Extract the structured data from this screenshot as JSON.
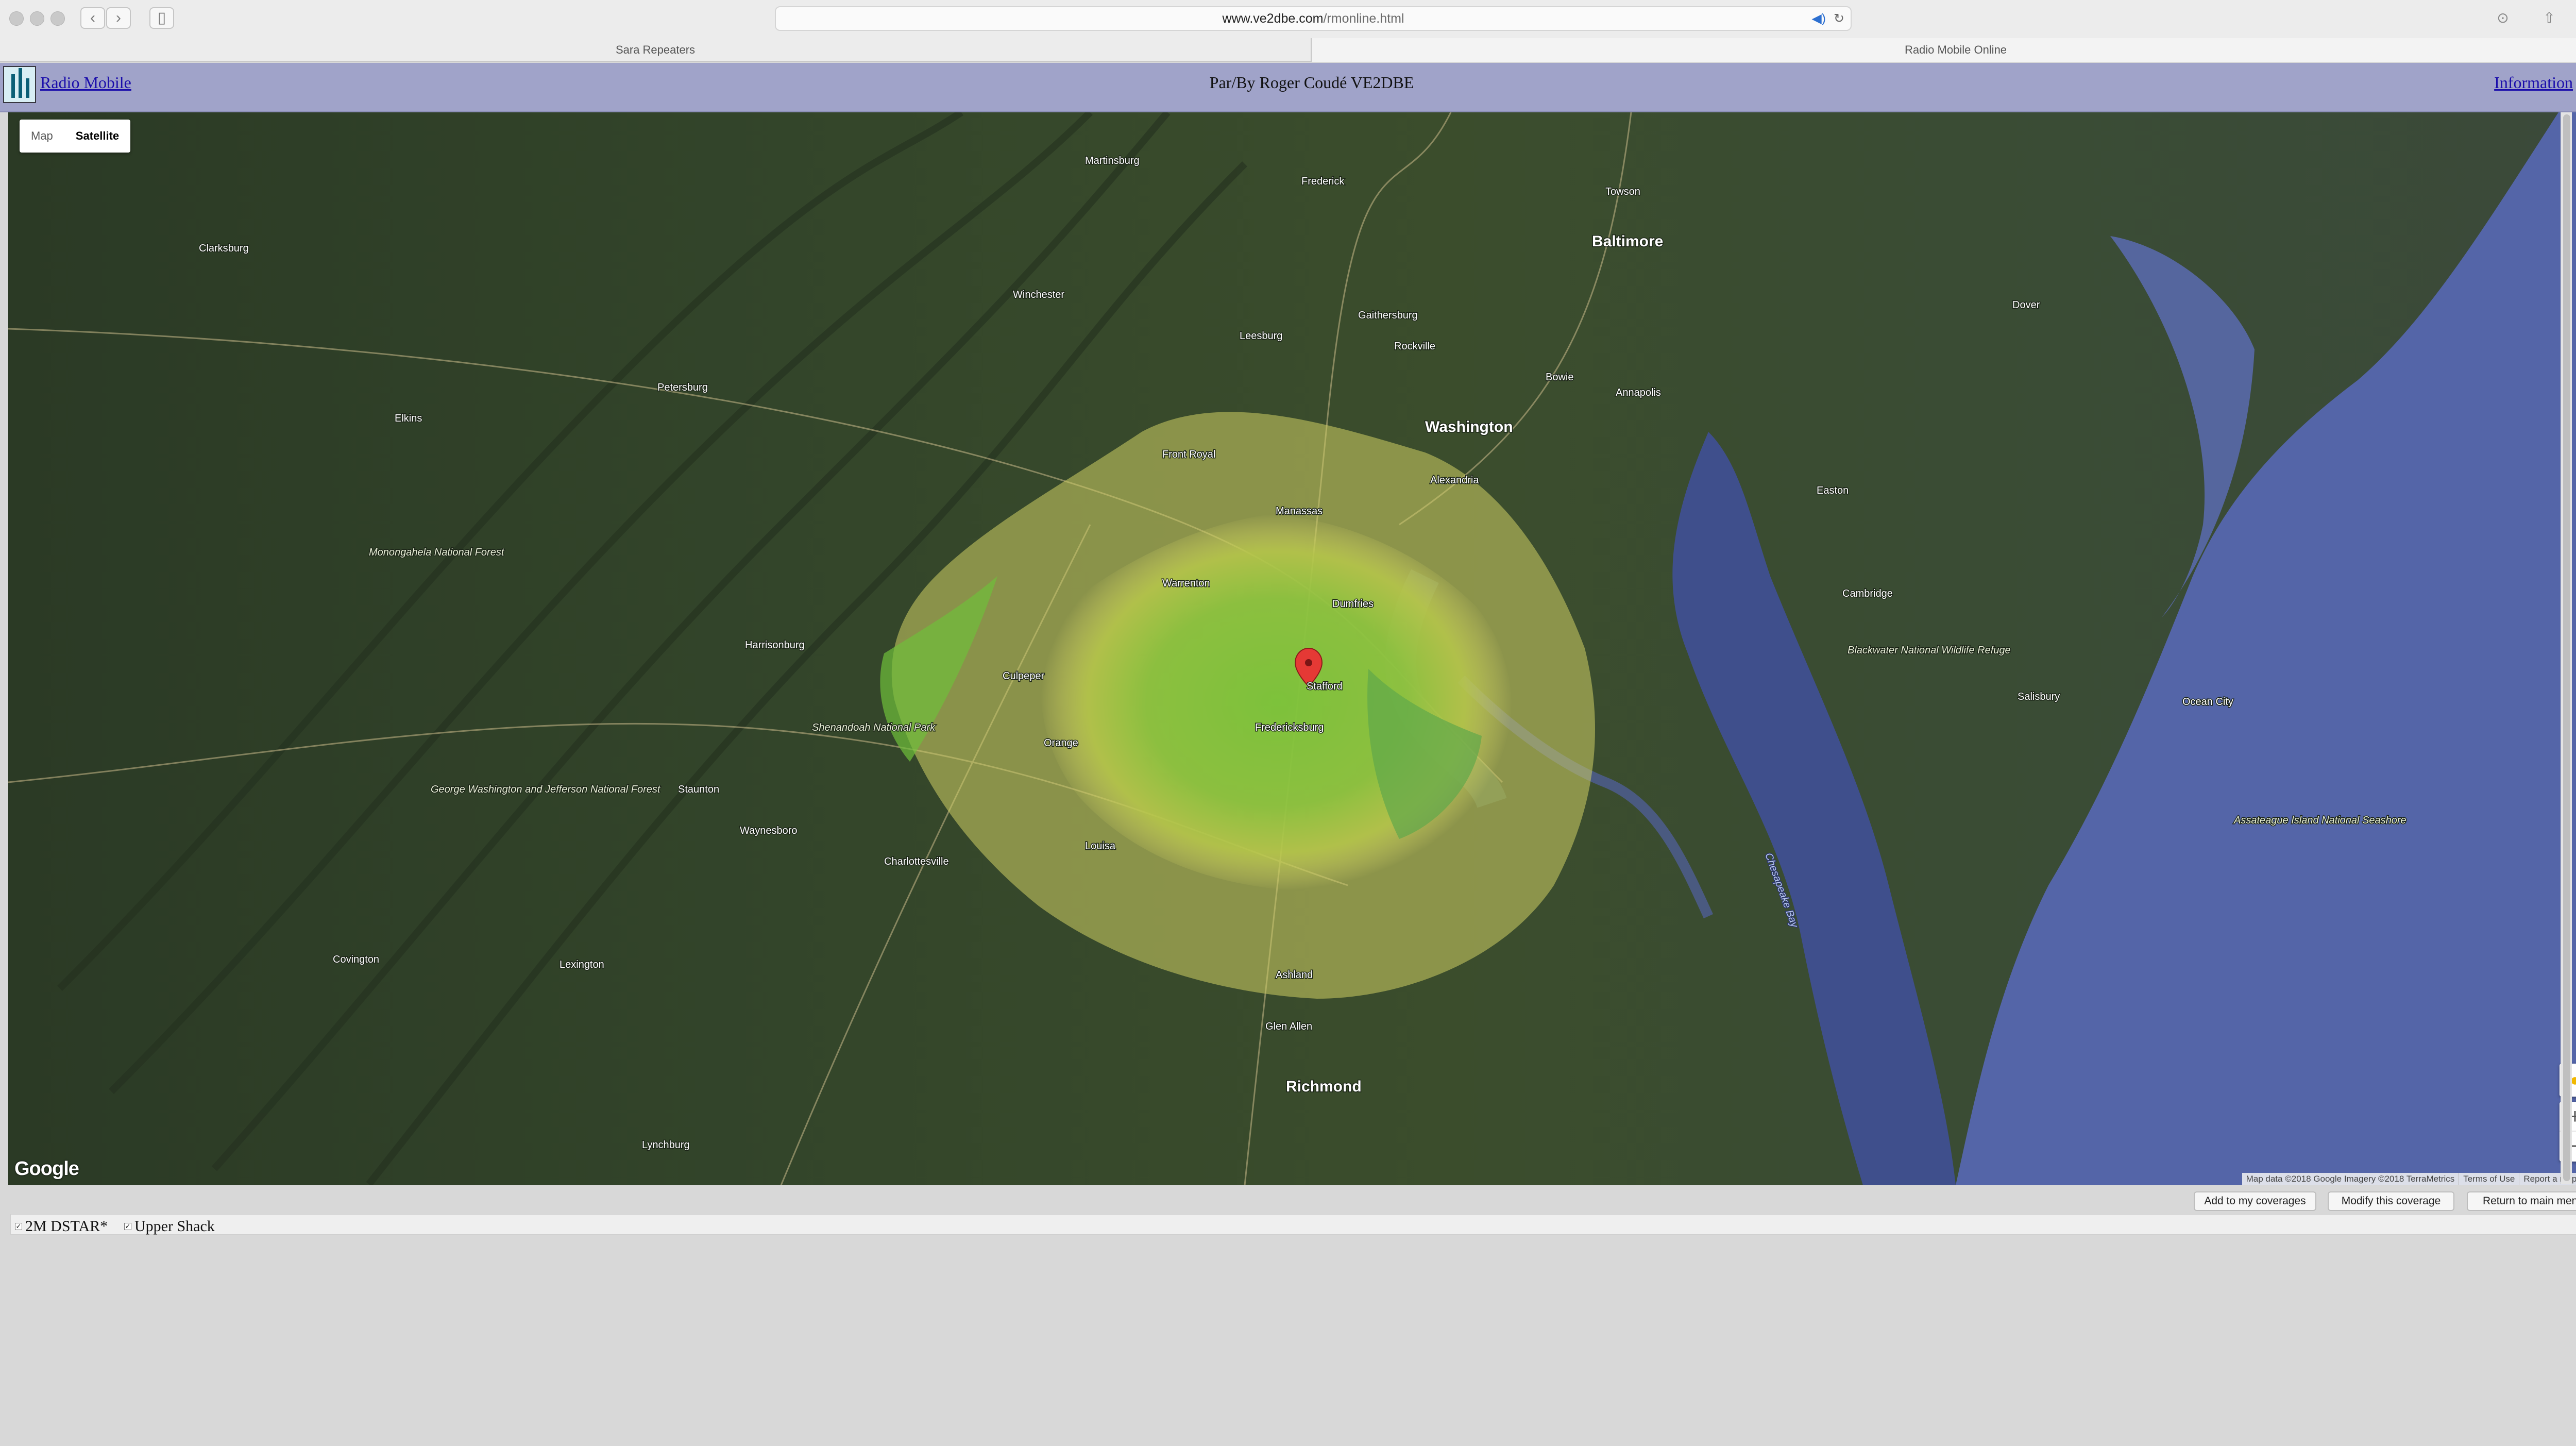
{
  "browser": {
    "url_host": "www.ve2dbe.com",
    "url_path": "/rmonline.html",
    "tabs": [
      "Sara Repeaters",
      "Radio Mobile Online"
    ]
  },
  "header": {
    "app_link": "Radio Mobile",
    "title": "Par/By Roger Coudé VE2DBE",
    "info_link": "Information"
  },
  "map": {
    "type_options": [
      "Map",
      "Satellite"
    ],
    "selected_type": "Satellite",
    "google_logo": "Google",
    "attribution": [
      "Map data ©2018 Google Imagery ©2018 TerraMetrics",
      "Terms of Use",
      "Report a map error"
    ],
    "labels": [
      "Martinsburg",
      "Frederick",
      "Baltimore",
      "Towson",
      "Annapolis",
      "Washington",
      "Alexandria",
      "Bowie",
      "Rockville",
      "Gaithersburg",
      "Leesburg",
      "Winchester",
      "Front Royal",
      "Warrenton",
      "Manassas",
      "Dumfries",
      "Stafford",
      "Fredericksburg",
      "Culpeper",
      "Orange",
      "Charlottesville",
      "Harrisonburg",
      "Staunton",
      "Waynesboro",
      "Louisa",
      "Ashland",
      "Richmond",
      "Lynchburg",
      "Glen Allen",
      "Dover",
      "Easton",
      "Cambridge",
      "Salisbury",
      "Ocean City",
      "Lexington",
      "Covington",
      "Elkins",
      "Petersburg",
      "Clarksburg",
      "Monongahela National Forest",
      "Shenandoah National Park",
      "George Washington and Jefferson National Forest",
      "Assateague Island National Seashore",
      "Chesapeake Bay",
      "Blackwater National Wildlife Refuge"
    ],
    "marker_color": "#e53935",
    "coverage_colors": [
      "#7cc43a",
      "#b7c84a",
      "#dcd86a"
    ]
  },
  "buttons": {
    "add": "Add to my coverages",
    "modify": "Modify this coverage",
    "return": "Return to main menu"
  },
  "legend": {
    "items": [
      "2M DSTAR*",
      "Upper Shack"
    ]
  }
}
